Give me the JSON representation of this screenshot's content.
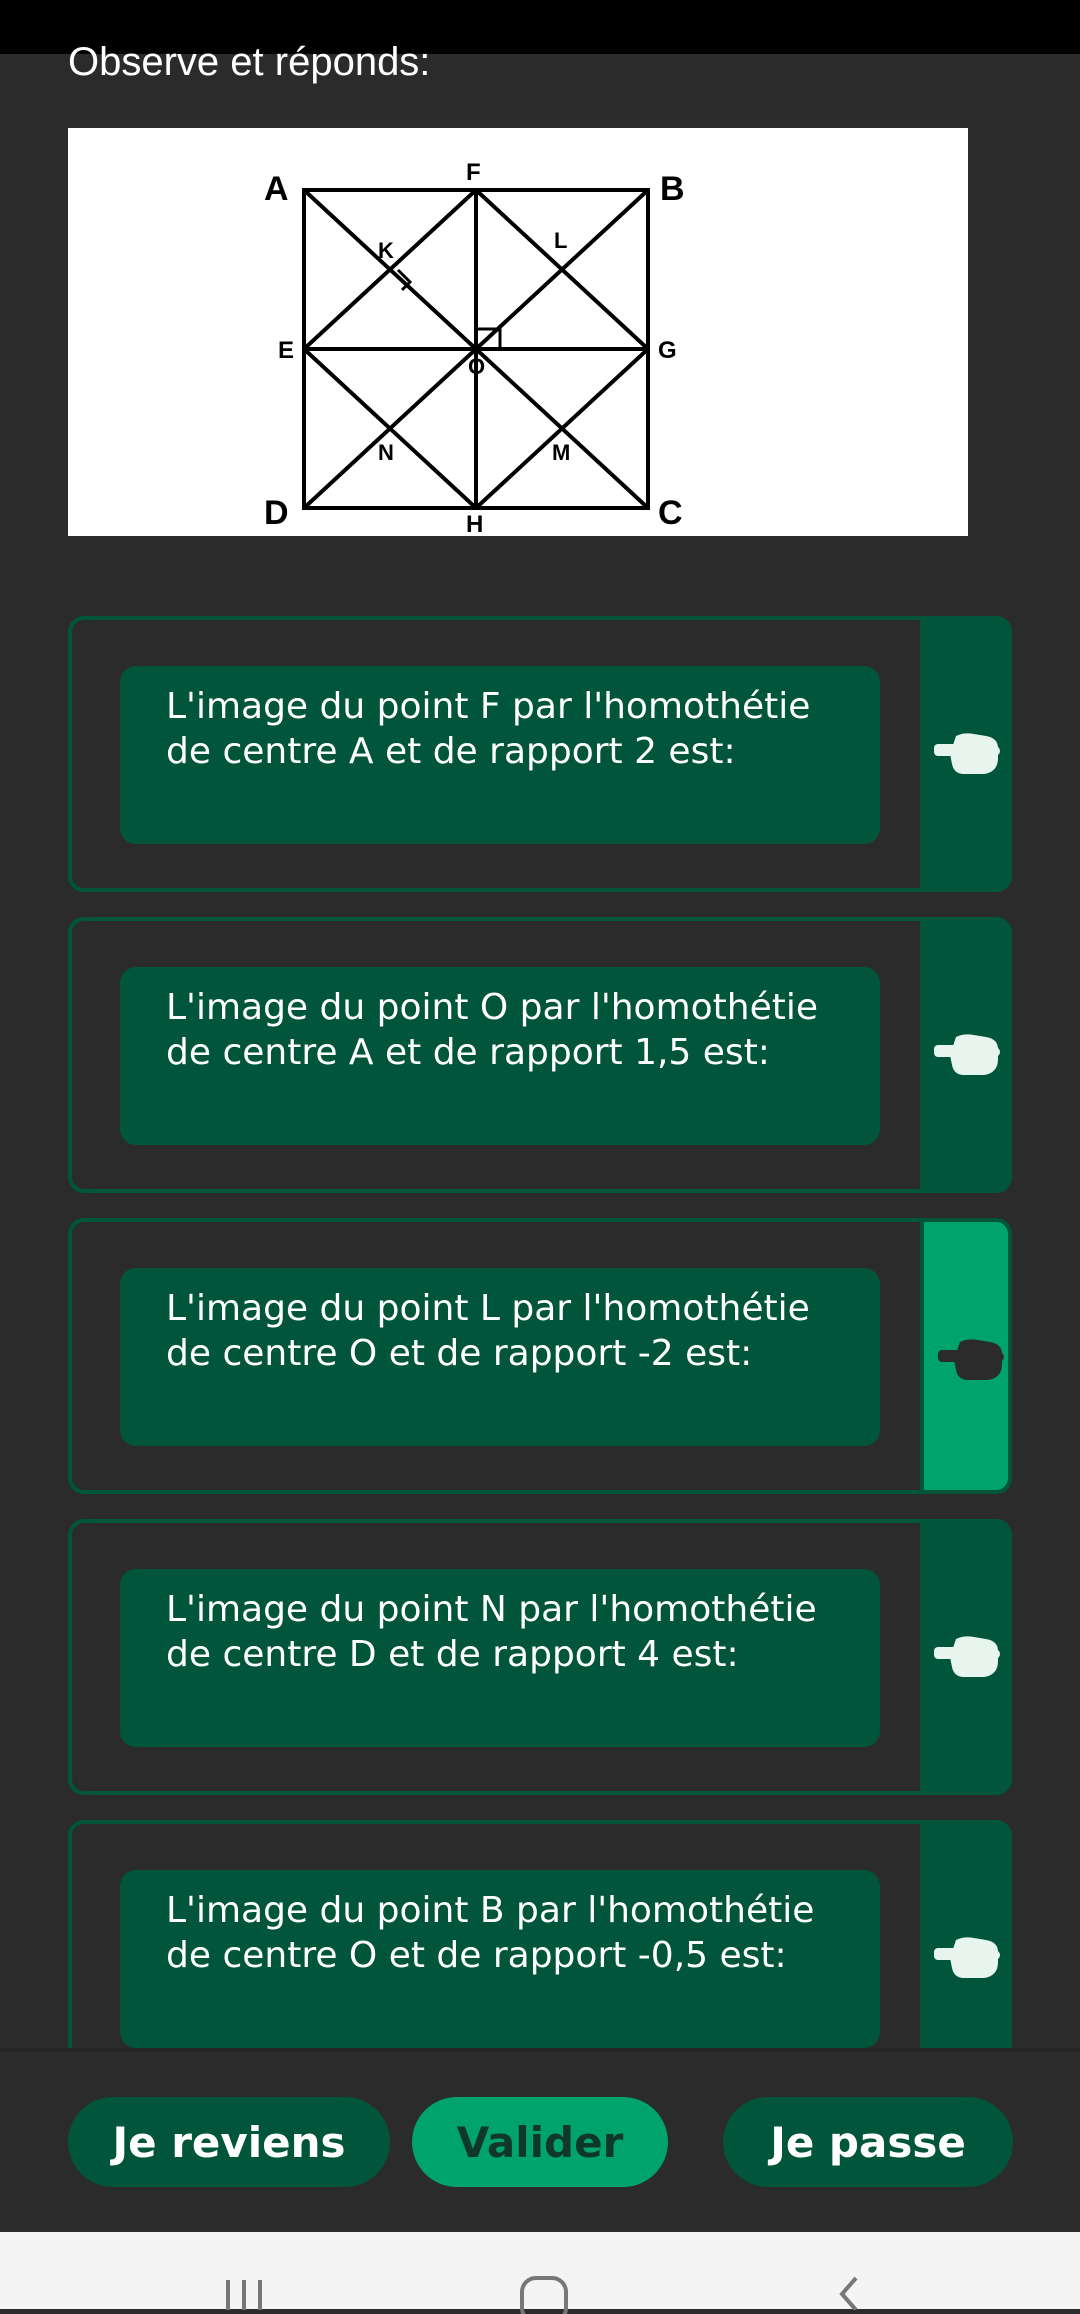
{
  "instruction": "Observe et réponds:",
  "figure": {
    "labels": {
      "A": "A",
      "B": "B",
      "C": "C",
      "D": "D",
      "E": "E",
      "F": "F",
      "G": "G",
      "H": "H",
      "K": "K",
      "L": "L",
      "M": "M",
      "N": "N",
      "O": "O"
    }
  },
  "questions": [
    {
      "text": "L'image du point F par l'homothétie de centre A et de rapport 2 est:",
      "active": false
    },
    {
      "text": "L'image du point O par l'homothétie de centre A et de rapport 1,5 est:",
      "active": false
    },
    {
      "text": "L'image du point L par l'homothétie de centre O et de rapport -2 est:",
      "active": true
    },
    {
      "text": "L'image du point N par l'homothétie de centre D et de rapport 4 est:",
      "active": false
    },
    {
      "text": "L'image du point B par l'homothétie de centre O et de rapport -0,5 est:",
      "active": false
    }
  ],
  "buttons": {
    "back": "Je reviens",
    "validate": "Valider",
    "skip": "Je passe"
  },
  "icons": {
    "pointer": "hand-pointing-left-icon",
    "nav_recent": "recent-apps-icon",
    "nav_home": "home-icon",
    "nav_back": "back-icon"
  },
  "colors": {
    "accent": "#00a36c",
    "card": "#00553a",
    "background": "#2b2b2b"
  }
}
